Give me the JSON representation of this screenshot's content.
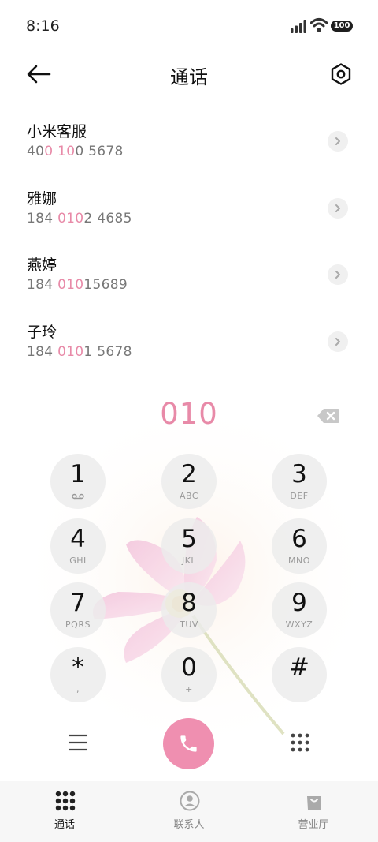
{
  "status": {
    "time": "8:16",
    "battery": "100"
  },
  "header": {
    "title": "通话"
  },
  "contacts": [
    {
      "name": "小米客服",
      "num_a": "40",
      "num_hl1": "0",
      "num_b": " ",
      "num_hl2": "10",
      "num_c": "0 5678"
    },
    {
      "name": "雅娜",
      "num_a": "184 ",
      "num_hl1": "010",
      "num_b": "",
      "num_hl2": "",
      "num_c": "2 4685"
    },
    {
      "name": "燕婷",
      "num_a": "184 ",
      "num_hl1": "010",
      "num_b": "",
      "num_hl2": "",
      "num_c": "15689"
    },
    {
      "name": "子玲",
      "num_a": "184 ",
      "num_hl1": "010",
      "num_b": "",
      "num_hl2": "",
      "num_c": "1 5678"
    }
  ],
  "dialer": {
    "input": "010"
  },
  "keys": [
    {
      "digit": "1",
      "letters": ""
    },
    {
      "digit": "2",
      "letters": "ABC"
    },
    {
      "digit": "3",
      "letters": "DEF"
    },
    {
      "digit": "4",
      "letters": "GHI"
    },
    {
      "digit": "5",
      "letters": "JKL"
    },
    {
      "digit": "6",
      "letters": "MNO"
    },
    {
      "digit": "7",
      "letters": "PQRS"
    },
    {
      "digit": "8",
      "letters": "TUV"
    },
    {
      "digit": "9",
      "letters": "WXYZ"
    },
    {
      "digit": "*",
      "letters": ","
    },
    {
      "digit": "0",
      "letters": "+"
    },
    {
      "digit": "#",
      "letters": ""
    }
  ],
  "tabs": [
    {
      "label": "通话",
      "icon": "dialpad-grid-icon",
      "active": true
    },
    {
      "label": "联系人",
      "icon": "contact-icon",
      "active": false
    },
    {
      "label": "营业厅",
      "icon": "shopping-bag-icon",
      "active": false
    }
  ],
  "colors": {
    "accent": "#ef8fb0",
    "highlight": "#e88aa8"
  }
}
